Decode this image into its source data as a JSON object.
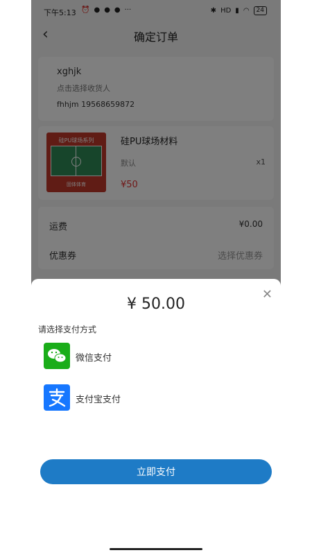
{
  "status_bar": {
    "time": "下午5:13",
    "icons": [
      "alarm",
      "app-1",
      "app-2",
      "app-3",
      "more"
    ],
    "signal": "HD",
    "battery": "24"
  },
  "nav": {
    "title": "确定订单"
  },
  "address": {
    "name": "xghjk",
    "hint": "点击选择收货人",
    "contact": "fhhjm 19568659872"
  },
  "product": {
    "name": "硅PU球场材料",
    "spec": "默认",
    "qty": "x1",
    "price": "¥50",
    "thumb_top_text": "硅PU球场系列",
    "thumb_bottom_text": "固体体育"
  },
  "fees": {
    "shipping_label": "运费",
    "shipping_value": "¥0.00",
    "coupon_label": "优惠券",
    "coupon_value": "选择优惠券"
  },
  "payment_sheet": {
    "amount": "¥ 50.00",
    "choose_label": "请选择支付方式",
    "options": [
      {
        "name": "微信支付",
        "icon": "wechat-icon"
      },
      {
        "name": "支付宝支付",
        "icon": "alipay-icon"
      }
    ],
    "pay_button": "立即支付"
  },
  "colors": {
    "accent": "#1e7bc6",
    "price_red": "#e03131",
    "wechat_green": "#1aad19",
    "alipay_blue": "#1677ff"
  }
}
